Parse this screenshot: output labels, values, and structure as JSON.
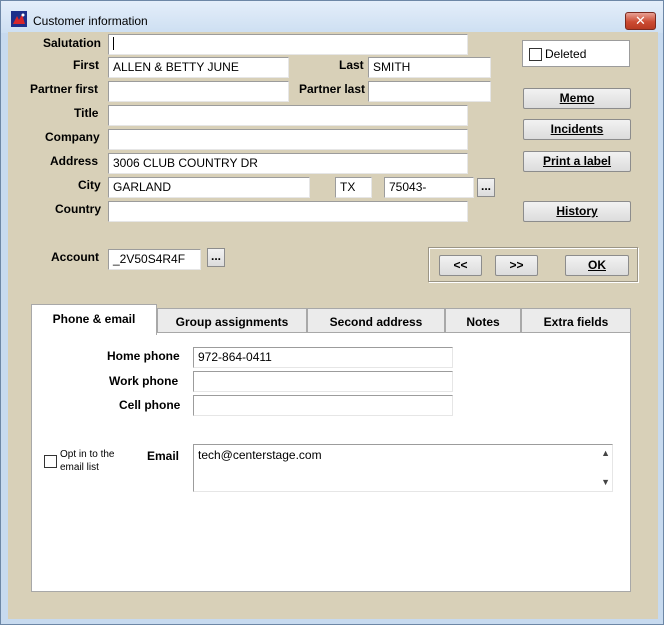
{
  "window": {
    "title": "Customer information"
  },
  "form": {
    "salutation": {
      "label": "Salutation",
      "value": ""
    },
    "first": {
      "label": "First",
      "value": "ALLEN & BETTY JUNE"
    },
    "last": {
      "label": "Last",
      "value": "SMITH"
    },
    "partner_first": {
      "label": "Partner first",
      "value": ""
    },
    "partner_last": {
      "label": "Partner last",
      "value": ""
    },
    "title": {
      "label": "Title",
      "value": ""
    },
    "company": {
      "label": "Company",
      "value": ""
    },
    "address": {
      "label": "Address",
      "value": "3006 CLUB COUNTRY DR"
    },
    "city": {
      "label": "City",
      "value": "GARLAND"
    },
    "state": {
      "value": "TX"
    },
    "zip": {
      "value": "75043-"
    },
    "zip_lookup_label": "...",
    "country": {
      "label": "Country",
      "value": ""
    },
    "account": {
      "label": "Account",
      "value": "_2V50S4R4F"
    },
    "account_lookup_label": "..."
  },
  "side": {
    "deleted_label": "Deleted",
    "memo_button": "Memo",
    "incidents_button": "Incidents",
    "print_label_button": "Print a label",
    "history_button": "History"
  },
  "nav": {
    "prev_label": "<<",
    "next_label": ">>",
    "ok_label": "OK"
  },
  "tabs": [
    {
      "label": "Phone & email"
    },
    {
      "label": "Group assignments"
    },
    {
      "label": "Second address"
    },
    {
      "label": "Notes"
    },
    {
      "label": "Extra fields"
    }
  ],
  "phone_email": {
    "home_phone": {
      "label": "Home phone",
      "value": "972-864-0411"
    },
    "work_phone": {
      "label": "Work phone",
      "value": ""
    },
    "cell_phone": {
      "label": "Cell phone",
      "value": ""
    },
    "opt_in_label_line1": "Opt in to the",
    "opt_in_label_line2": "email list",
    "email": {
      "label": "Email",
      "value": "tech@centerstage.com"
    }
  }
}
